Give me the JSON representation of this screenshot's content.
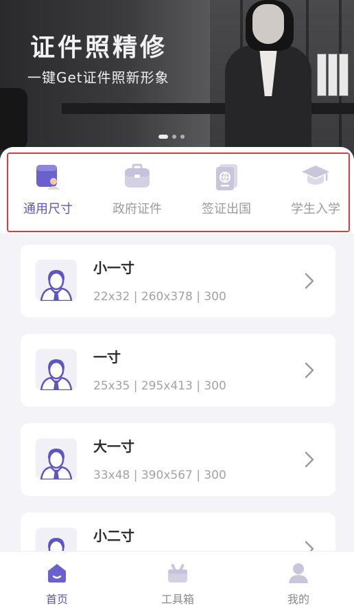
{
  "banner": {
    "title": "证件照精修",
    "subtitle": "一键Get证件照新形象",
    "slides": 3,
    "active_slide": 1
  },
  "categories": [
    {
      "label": "通用尺寸",
      "icon": "id-card-person-icon",
      "active": true
    },
    {
      "label": "政府证件",
      "icon": "briefcase-icon",
      "active": false
    },
    {
      "label": "签证出国",
      "icon": "passport-icon",
      "active": false
    },
    {
      "label": "学生入学",
      "icon": "graduation-cap-icon",
      "active": false
    }
  ],
  "sizes": [
    {
      "name": "小一寸",
      "spec": "22x32 | 260x378 | 300"
    },
    {
      "name": "一寸",
      "spec": "25x35 | 295x413 | 300"
    },
    {
      "name": "大一寸",
      "spec": "33x48 | 390x567 | 300"
    },
    {
      "name": "小二寸",
      "spec": ""
    }
  ],
  "tabbar": [
    {
      "label": "首页",
      "icon": "home-icon",
      "active": true
    },
    {
      "label": "工具箱",
      "icon": "toolbox-icon",
      "active": false
    },
    {
      "label": "我的",
      "icon": "user-icon",
      "active": false
    }
  ],
  "colors": {
    "accent": "#5d55c4",
    "accent_light": "#8e86dd",
    "inactive_icon": "#c9c6dc",
    "highlight_border": "#e23a3a",
    "background": "#f4f3f8"
  }
}
